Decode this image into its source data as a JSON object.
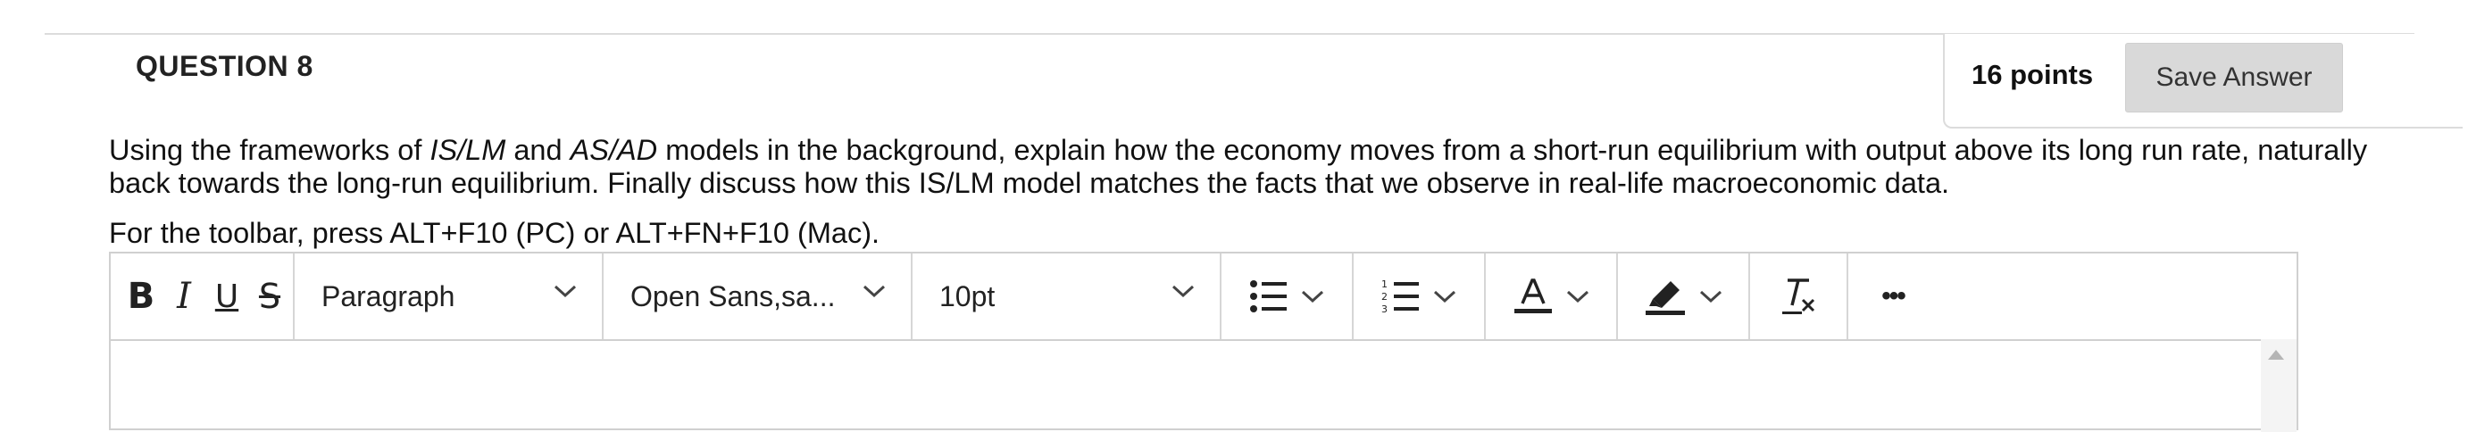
{
  "question": {
    "title": "QUESTION 8",
    "points": "16 points",
    "save_label": "Save Answer",
    "text_parts": [
      {
        "text": "Using the frameworks of ",
        "italic": false
      },
      {
        "text": "IS/LM",
        "italic": true
      },
      {
        "text": " and ",
        "italic": false
      },
      {
        "text": "AS/AD",
        "italic": true
      },
      {
        "text": " models in the background, explain how the economy moves from a short-run equilibrium with output above its long run rate, naturally back towards the long-run equilibrium. Finally discuss how this IS/LM model matches the facts that we observe in real-life macroeconomic data.",
        "italic": false
      }
    ]
  },
  "editor": {
    "toolbar_hint": "For the toolbar, press ALT+F10 (PC) or ALT+FN+F10 (Mac).",
    "bold_label": "B",
    "italic_label": "I",
    "underline_label": "U",
    "strike_label": "S",
    "block_format": "Paragraph",
    "font_family": "Open Sans,sa...",
    "font_size": "10pt",
    "more_label": "•••"
  },
  "icons": {
    "bullet_list": "bullet-list-icon",
    "numbered_list": "numbered-list-icon",
    "text_color": "text-color-icon",
    "highlight": "highlight-icon",
    "clear_format": "clear-format-icon",
    "chevron": "chevron-down-icon"
  }
}
